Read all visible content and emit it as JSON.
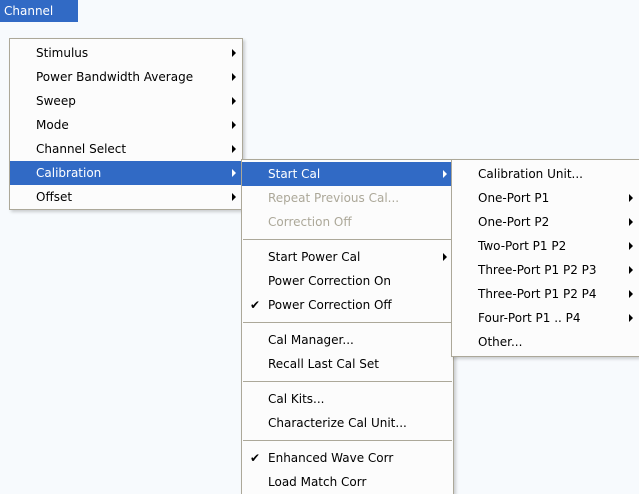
{
  "menubar": {
    "channel": "Channel"
  },
  "channel_menu": [
    {
      "label": "Stimulus",
      "submenu": true
    },
    {
      "label": "Power Bandwidth Average",
      "submenu": true
    },
    {
      "label": "Sweep",
      "submenu": true
    },
    {
      "label": "Mode",
      "submenu": true
    },
    {
      "label": "Channel Select",
      "submenu": true
    },
    {
      "label": "Calibration",
      "submenu": true,
      "highlighted": true
    },
    {
      "label": "Offset",
      "submenu": true
    }
  ],
  "calibration_menu": {
    "start_cal": "Start Cal",
    "repeat_previous_cal": "Repeat Previous Cal...",
    "correction_off": "Correction Off",
    "start_power_cal": "Start Power Cal",
    "power_correction_on": "Power Correction On",
    "power_correction_off": "Power Correction Off",
    "cal_manager": "Cal Manager...",
    "recall_last_cal_set": "Recall Last Cal Set",
    "cal_kits": "Cal Kits...",
    "characterize_cal_unit": "Characterize Cal Unit...",
    "enhanced_wave_corr": "Enhanced Wave Corr",
    "load_match_corr": "Load Match Corr",
    "check_mark": "✔"
  },
  "start_cal_menu": [
    {
      "label": "Calibration Unit...",
      "submenu": false
    },
    {
      "label": "One-Port P1",
      "submenu": true
    },
    {
      "label": "One-Port P2",
      "submenu": true
    },
    {
      "label": "Two-Port P1 P2",
      "submenu": true
    },
    {
      "label": "Three-Port P1 P2 P3",
      "submenu": true
    },
    {
      "label": "Three-Port P1 P2 P4",
      "submenu": true
    },
    {
      "label": "Four-Port P1 .. P4",
      "submenu": true
    },
    {
      "label": "Other...",
      "submenu": false
    }
  ],
  "colors": {
    "highlight": "#316ac5",
    "disabled": "#aca899",
    "menu_bg": "#fcfcfc"
  }
}
